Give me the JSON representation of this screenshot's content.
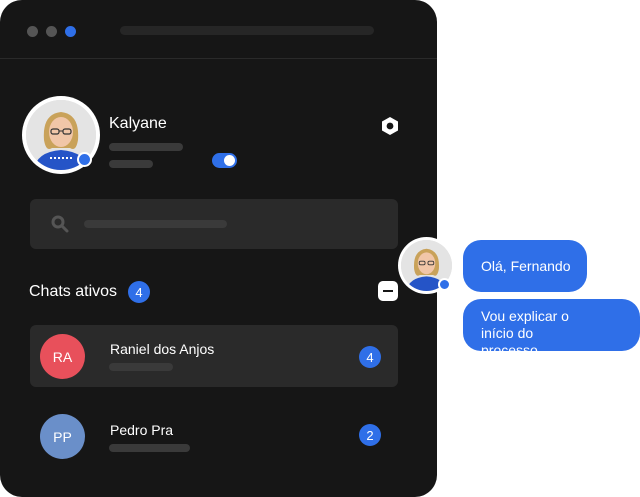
{
  "window": {
    "traffic_lights": [
      "#555555",
      "#555555",
      "#2f6fe8"
    ]
  },
  "profile": {
    "name": "Kalyane",
    "status_toggle_on": true
  },
  "icons": {
    "settings": "settings-hexagon-icon",
    "search": "search-icon",
    "collapse": "minus-icon"
  },
  "active_chats": {
    "title": "Chats ativos",
    "count": "4",
    "items": [
      {
        "initials": "RA",
        "name": "Raniel dos Anjos",
        "unread": "4",
        "avatar_color": "#e8505b",
        "selected": true
      },
      {
        "initials": "PP",
        "name": "Pedro Pra",
        "unread": "2",
        "avatar_color": "#6a8fc9",
        "selected": false
      }
    ]
  },
  "messages": [
    {
      "text": "Olá, Fernando"
    },
    {
      "text": "Vou explicar o início do processo."
    }
  ],
  "colors": {
    "accent": "#2f6fe8",
    "window_bg": "#161616",
    "panel_bg": "#2a2a2a"
  }
}
